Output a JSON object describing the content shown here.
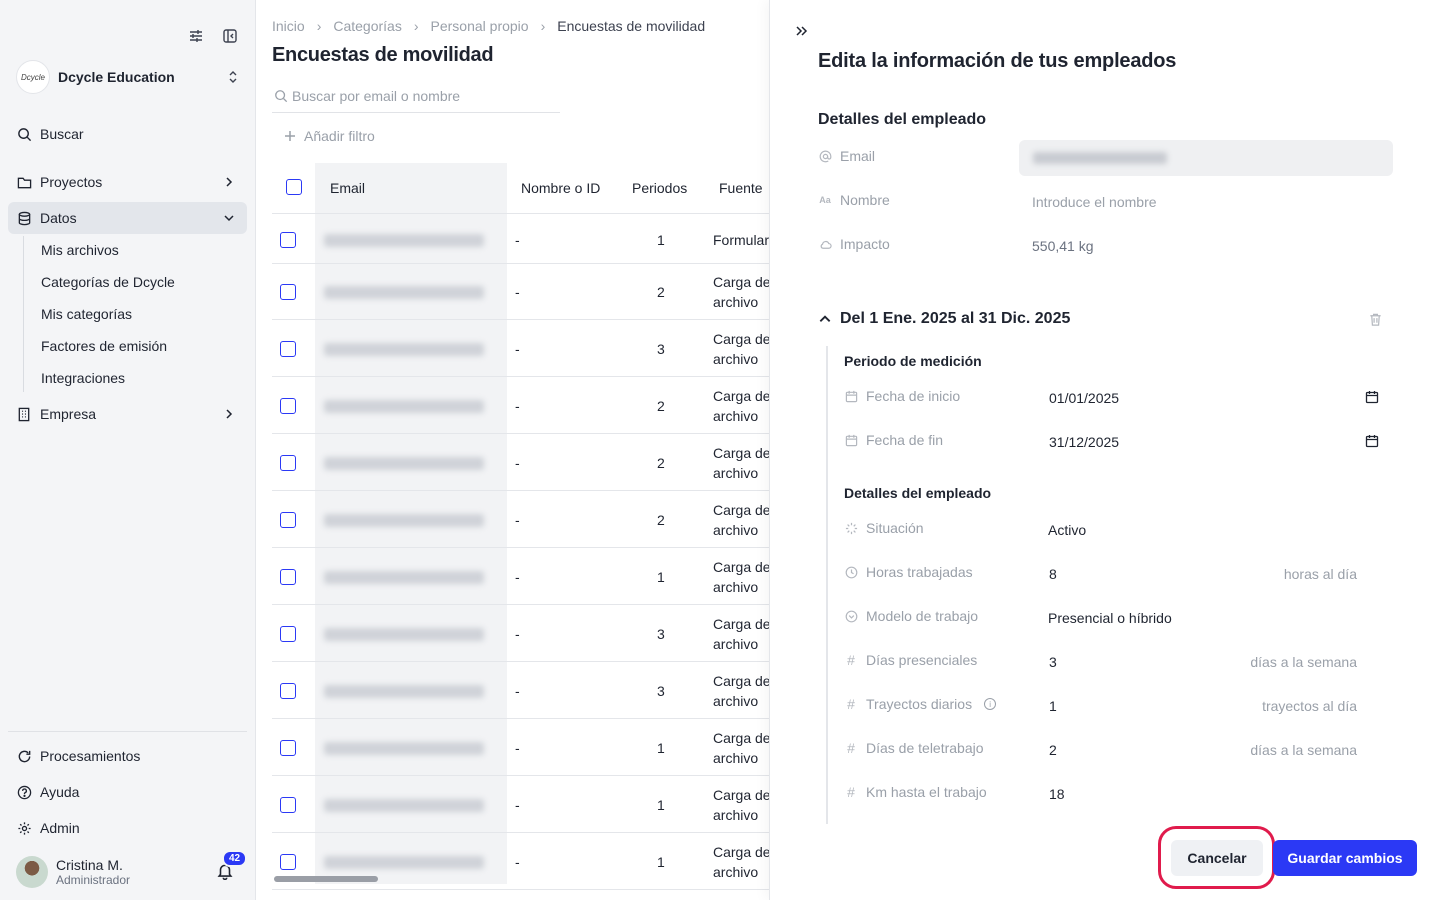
{
  "sidebar": {
    "org_name": "Dcycle Education",
    "org_logo_text": "Dcycle",
    "search_label": "Buscar",
    "items": [
      {
        "label": "Proyectos"
      },
      {
        "label": "Datos"
      },
      {
        "label": "Empresa"
      }
    ],
    "data_sub_items": [
      "Mis archivos",
      "Categorías de Dcycle",
      "Mis categorías",
      "Factores de emisión",
      "Integraciones"
    ],
    "bottom_items": [
      {
        "label": "Procesamientos"
      },
      {
        "label": "Ayuda"
      },
      {
        "label": "Admin"
      }
    ],
    "user": {
      "name": "Cristina M.",
      "role": "Administrador",
      "notifications": "42"
    }
  },
  "main": {
    "breadcrumb": [
      "Inicio",
      "Categorías",
      "Personal propio",
      "Encuestas de movilidad"
    ],
    "title": "Encuestas de movilidad",
    "search_placeholder": "Buscar por email o nombre",
    "add_filter": "Añadir filtro",
    "columns": [
      "Email",
      "Nombre o ID",
      "Periodos",
      "Fuente"
    ],
    "rows": [
      {
        "name": "-",
        "periods": "1",
        "source_l1": "Formular",
        "source_l2": ""
      },
      {
        "name": "-",
        "periods": "2",
        "source_l1": "Carga de",
        "source_l2": "archivo"
      },
      {
        "name": "-",
        "periods": "3",
        "source_l1": "Carga de",
        "source_l2": "archivo"
      },
      {
        "name": "-",
        "periods": "2",
        "source_l1": "Carga de",
        "source_l2": "archivo"
      },
      {
        "name": "-",
        "periods": "2",
        "source_l1": "Carga de",
        "source_l2": "archivo"
      },
      {
        "name": "-",
        "periods": "2",
        "source_l1": "Carga de",
        "source_l2": "archivo"
      },
      {
        "name": "-",
        "periods": "1",
        "source_l1": "Carga de",
        "source_l2": "archivo"
      },
      {
        "name": "-",
        "periods": "3",
        "source_l1": "Carga de",
        "source_l2": "archivo"
      },
      {
        "name": "-",
        "periods": "3",
        "source_l1": "Carga de",
        "source_l2": "archivo"
      },
      {
        "name": "-",
        "periods": "1",
        "source_l1": "Carga de",
        "source_l2": "archivo"
      },
      {
        "name": "-",
        "periods": "1",
        "source_l1": "Carga de",
        "source_l2": "archivo"
      },
      {
        "name": "-",
        "periods": "1",
        "source_l1": "Carga de",
        "source_l2": "archivo"
      }
    ]
  },
  "panel": {
    "title": "Edita la información de tus empleados",
    "details_title": "Detalles del empleado",
    "email_label": "Email",
    "name_label": "Nombre",
    "name_placeholder": "Introduce el nombre",
    "impact_label": "Impacto",
    "impact_value": "550,41 kg",
    "period_title": "Del 1 Ene. 2025 al 31 Dic. 2025",
    "measure_title": "Periodo de medición",
    "start_label": "Fecha de inicio",
    "start_value": "01/01/2025",
    "end_label": "Fecha de fin",
    "end_value": "31/12/2025",
    "employee_details_title": "Detalles del empleado",
    "status_label": "Situación",
    "status_value": "Activo",
    "hours_label": "Horas trabajadas",
    "hours_value": "8",
    "hours_unit": "horas al día",
    "model_label": "Modelo de trabajo",
    "model_value": "Presencial o híbrido",
    "onsite_label": "Días presenciales",
    "onsite_value": "3",
    "onsite_unit": "días a la semana",
    "trips_label": "Trayectos diarios",
    "trips_value": "1",
    "trips_unit": "trayectos al día",
    "remote_label": "Días de teletrabajo",
    "remote_value": "2",
    "remote_unit": "días a la semana",
    "km_label": "Km hasta el trabajo",
    "km_value": "18",
    "cancel": "Cancelar",
    "save": "Guardar cambios"
  },
  "colors": {
    "accent": "#2b39f5",
    "highlight": "#e01b4c"
  }
}
